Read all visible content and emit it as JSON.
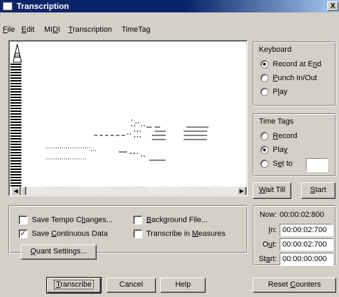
{
  "window": {
    "title": "Transcription",
    "close_glyph": "X"
  },
  "menu": {
    "items": [
      {
        "label": "File"
      },
      {
        "label": "Edit"
      },
      {
        "label": "MIDI"
      },
      {
        "label": "Transcription"
      },
      {
        "label": "TimeTag"
      }
    ]
  },
  "keyboard_group": {
    "title": "Keyboard",
    "options": [
      {
        "label": "Record at End",
        "selected": true
      },
      {
        "label": "Punch In/Out",
        "selected": false
      },
      {
        "label": "Play",
        "selected": false
      }
    ]
  },
  "time_tags_group": {
    "title": "Time Tags",
    "options": [
      {
        "label": "Record",
        "selected": false
      },
      {
        "label": "Play",
        "selected": true
      },
      {
        "label": "Set to",
        "selected": false
      }
    ],
    "set_to_value": ""
  },
  "wait_till_button": "Wait Till",
  "start_button": "Start",
  "options_panel": {
    "save_tempo": {
      "label": "Save Tempo Changes...",
      "checked": false
    },
    "background_file": {
      "label": "Background File...",
      "checked": false
    },
    "save_continuous": {
      "label": "Save Continuous Data",
      "checked": true
    },
    "transcribe_in_measures": {
      "label": "Transcribe in Measures",
      "checked": false
    },
    "quant_settings": "Quant Settings...",
    "check_mark": "✓"
  },
  "counters": {
    "now_label": "Now:",
    "now_value": "00:00:02:800",
    "in_label": "In:",
    "in_value": "00:00:02:700",
    "out_label": "Out:",
    "out_value": "00:00:02:700",
    "start_label": "Start:",
    "start_value": "00:00:00:000"
  },
  "bottom_buttons": {
    "transcribe": "Transcribe",
    "cancel": "Cancel",
    "help": "Help",
    "reset_counters": "Reset Counters"
  },
  "scrollbar": {
    "left_glyph": "◀",
    "right_glyph": "▶"
  },
  "icons": {
    "metronome": "metronome-icon",
    "close": "close-icon"
  }
}
